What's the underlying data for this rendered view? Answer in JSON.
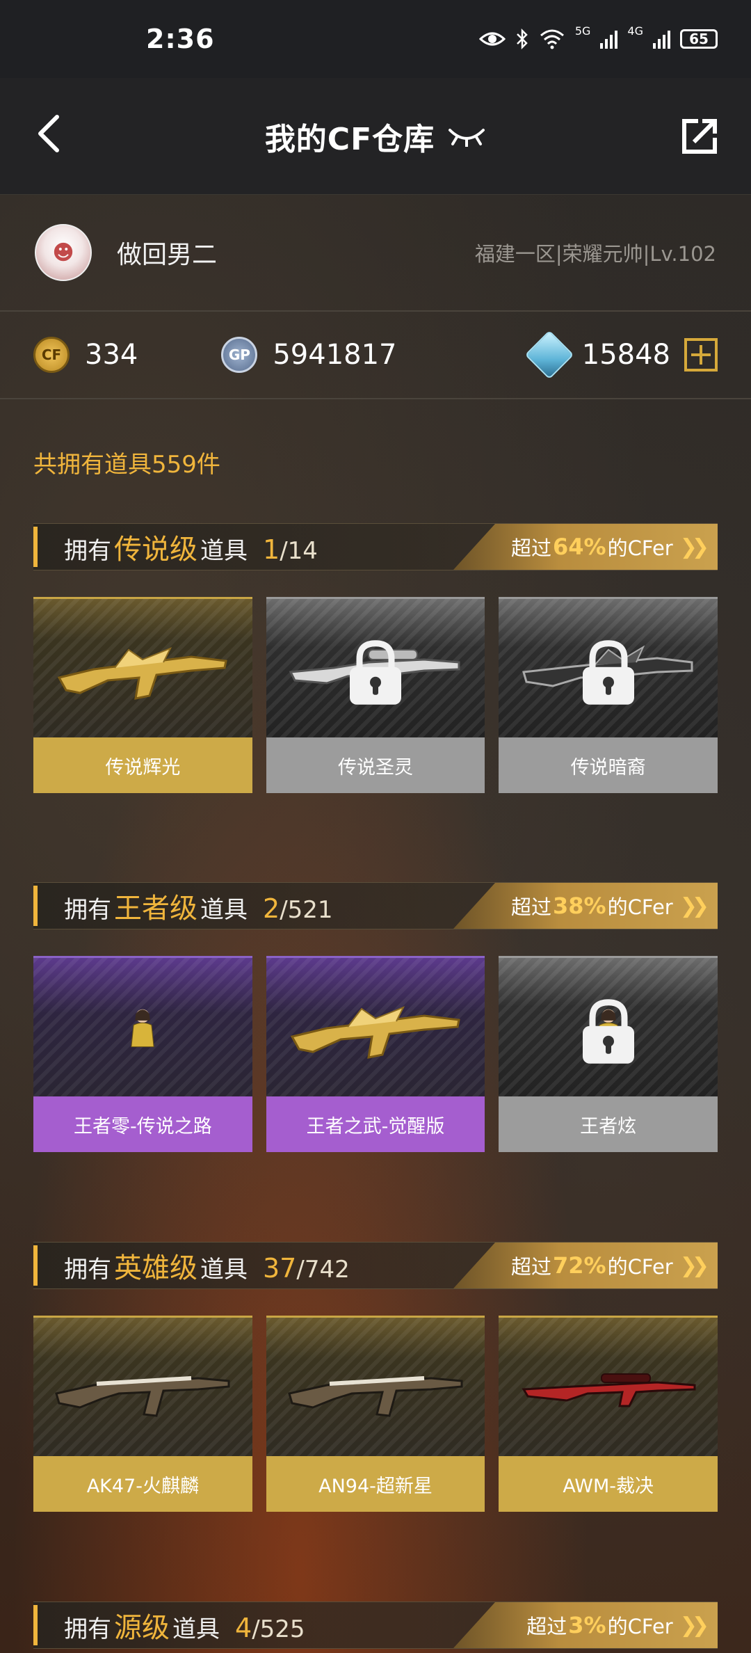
{
  "status_bar": {
    "time": "2:36",
    "signal_a": "5G",
    "signal_b": "4G",
    "battery": "65"
  },
  "header": {
    "title": "我的CF仓库"
  },
  "user": {
    "name": "做回男二",
    "server": "福建一区|荣耀元帅|Lv.102"
  },
  "currency": {
    "cf_points": "334",
    "gp": "5941817",
    "diamonds": "15848",
    "cf_icon_text": "CF",
    "gp_icon_text": "GP"
  },
  "total": "共拥有道具559件",
  "sections": [
    {
      "prefix": "拥有",
      "level": "传说级",
      "suffix": "道具",
      "owned": "1",
      "total": "/14",
      "beat_prefix": "超过",
      "beat_pct": "64%",
      "beat_suffix": "的CFer",
      "items": [
        {
          "name": "传说辉光",
          "style": "gold",
          "locked": false,
          "icon": "gold-rifle"
        },
        {
          "name": "传说圣灵",
          "style": "gray",
          "locked": true,
          "icon": "sniper-rifle"
        },
        {
          "name": "传说暗裔",
          "style": "gray",
          "locked": true,
          "icon": "dark-rifle"
        }
      ]
    },
    {
      "prefix": "拥有",
      "level": "王者级",
      "suffix": "道具",
      "owned": "2",
      "total": "/521",
      "beat_prefix": "超过",
      "beat_pct": "38%",
      "beat_suffix": "的CFer",
      "items": [
        {
          "name": "王者零-传说之路",
          "style": "purple",
          "locked": false,
          "icon": "character"
        },
        {
          "name": "王者之武-觉醒版",
          "style": "purple",
          "locked": false,
          "icon": "gold-rifle"
        },
        {
          "name": "王者炫",
          "style": "gray",
          "locked": true,
          "icon": "character"
        }
      ]
    },
    {
      "prefix": "拥有",
      "level": "英雄级",
      "suffix": "道具",
      "owned": "37",
      "total": "/742",
      "beat_prefix": "超过",
      "beat_pct": "72%",
      "beat_suffix": "的CFer",
      "items": [
        {
          "name": "AK47-火麒麟",
          "style": "gold",
          "locked": false,
          "icon": "ak-rifle"
        },
        {
          "name": "AN94-超新星",
          "style": "gold",
          "locked": false,
          "icon": "ak-rifle"
        },
        {
          "name": "AWM-裁决",
          "style": "gold",
          "locked": false,
          "icon": "red-sniper"
        }
      ]
    },
    {
      "prefix": "拥有",
      "level": "源级",
      "suffix": "道具",
      "owned": "4",
      "total": "/525",
      "beat_prefix": "超过",
      "beat_pct": "3%",
      "beat_suffix": "的CFer",
      "items": []
    }
  ]
}
